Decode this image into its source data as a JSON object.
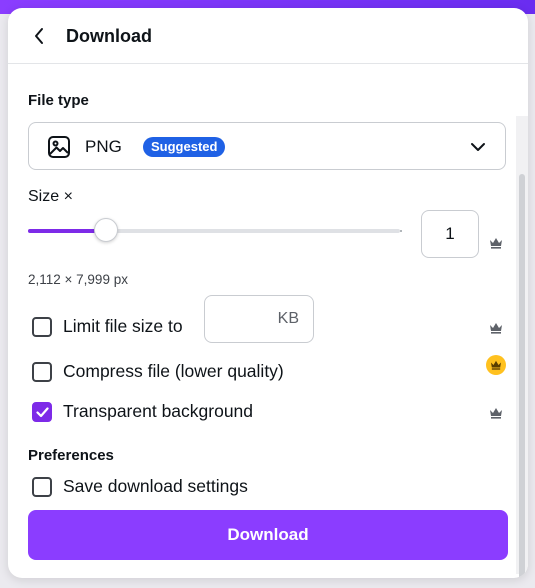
{
  "header": {
    "title": "Download"
  },
  "file_type": {
    "label": "File type",
    "value": "PNG",
    "badge": "Suggested"
  },
  "size": {
    "label": "Size ×",
    "slider_fraction": 0.21,
    "input_value": "1",
    "dimensions": "2,112 × 7,999 px"
  },
  "options": {
    "limit_file_size_label": "Limit file size to",
    "limit_file_size_checked": false,
    "kb_placeholder": "KB",
    "compress_label": "Compress file (lower quality)",
    "compress_checked": false,
    "transparent_label": "Transparent background",
    "transparent_checked": true
  },
  "preferences": {
    "label": "Preferences",
    "save_settings_label": "Save download settings",
    "save_settings_checked": false
  },
  "download_button": {
    "label": "Download"
  },
  "icons": {
    "back": "chevron-left-icon",
    "file_type": "image-icon",
    "dropdown": "chevron-down-icon",
    "pro": "crown-icon"
  },
  "colors": {
    "accent": "#8b3dff",
    "slider_fill": "#7d2ae8",
    "badge": "#1f61e5",
    "pro_gold": "#ffc11f"
  }
}
